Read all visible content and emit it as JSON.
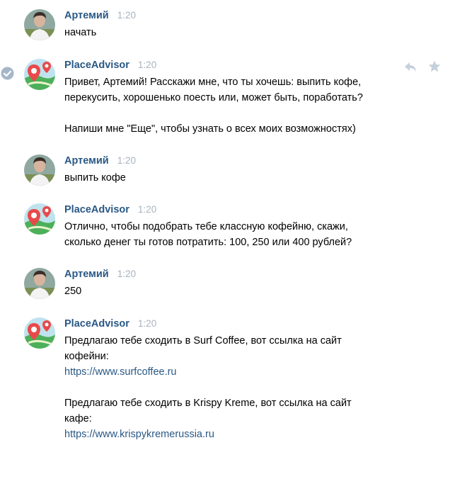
{
  "messages": [
    {
      "author": "Артемий",
      "time": "1:20",
      "lines": [
        "начать"
      ]
    },
    {
      "author": "PlaceAdvisor",
      "time": "1:20",
      "lines": [
        "Привет, Артемий! Расскажи мне, что ты хочешь: выпить кофе,",
        "перекусить, хорошенько поесть или, может быть, поработать?",
        "",
        "Напиши мне \"Еще\", чтобы узнать о всех моих возможностях)"
      ]
    },
    {
      "author": "Артемий",
      "time": "1:20",
      "lines": [
        "выпить кофе"
      ]
    },
    {
      "author": "PlaceAdvisor",
      "time": "1:20",
      "lines": [
        "Отлично, чтобы подобрать тебе классную кофейню, скажи,",
        "сколько денег ты готов потратить: 100, 250 или 400 рублей?"
      ]
    },
    {
      "author": "Артемий",
      "time": "1:20",
      "lines": [
        "250"
      ]
    },
    {
      "author": "PlaceAdvisor",
      "time": "1:20",
      "lines": [
        "Предлагаю тебе сходить в Surf Coffee, вот ссылка на сайт",
        "кофейни:"
      ],
      "link1": "https://www.surfcoffee.ru",
      "lines2": [
        "Предлагаю тебе сходить в Krispy Kreme, вот ссылка на сайт",
        "кафе:"
      ],
      "link2": "https://www.krispykremerussia.ru"
    }
  ],
  "icons": {
    "read_status": "checkmark-circle-icon",
    "reply": "reply-icon",
    "favorite": "star-icon"
  },
  "colors": {
    "author": "#2a5885",
    "time": "#a8b2bd",
    "link": "#2a5885",
    "icon": "#c5d0db"
  }
}
